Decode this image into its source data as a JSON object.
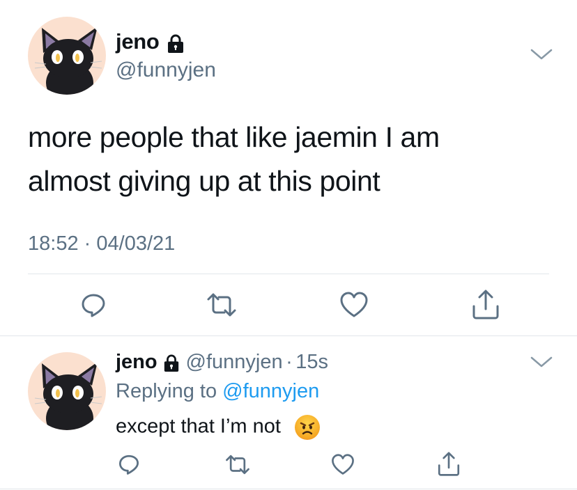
{
  "tweet": {
    "author_name": "jeno",
    "author_handle": "@funnyjen",
    "text_line1": "more people that like jaemin I am",
    "text_line2": "almost giving up at this point",
    "time": "18:52",
    "separator": "·",
    "date": "04/03/21"
  },
  "reply": {
    "author_name": "jeno",
    "author_handle": "@funnyjen",
    "separator": "·",
    "age": "15s",
    "replying_prefix": "Replying to",
    "replying_to": "@funnyjen",
    "text": "except that I’m not"
  },
  "icons": {
    "lock": "lock-icon",
    "chevron": "chevron-down-icon",
    "reply": "reply-icon",
    "retweet": "retweet-icon",
    "like": "heart-icon",
    "share": "share-icon",
    "emoji": "angry-face-emoji"
  },
  "colors": {
    "secondary_text": "#5b7083",
    "link": "#1d9bf0",
    "divider": "#e1e6ea",
    "avatar_bg": "#fbe0cf"
  }
}
